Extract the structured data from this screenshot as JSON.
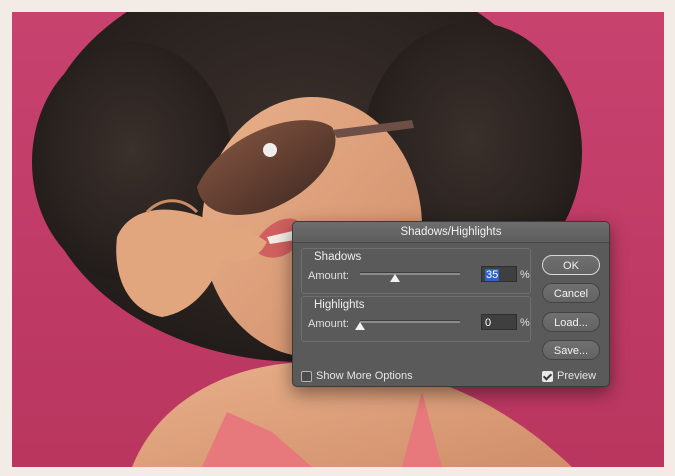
{
  "dialog": {
    "title": "Shadows/Highlights",
    "shadows": {
      "title": "Shadows",
      "amount_label": "Amount:",
      "amount_value": "35",
      "amount_unit": "%",
      "slider_fraction": 0.35
    },
    "highlights": {
      "title": "Highlights",
      "amount_label": "Amount:",
      "amount_value": "0",
      "amount_unit": "%",
      "slider_fraction": 0.0
    },
    "buttons": {
      "ok": "OK",
      "cancel": "Cancel",
      "load": "Load...",
      "save": "Save..."
    },
    "show_more_options": {
      "label": "Show More Options",
      "checked": false
    },
    "preview": {
      "label": "Preview",
      "checked": true
    }
  },
  "colors": {
    "background_magenta": "#c23d69",
    "dialog_bg": "#5a5a5a",
    "selection_blue": "#2f63c9"
  }
}
